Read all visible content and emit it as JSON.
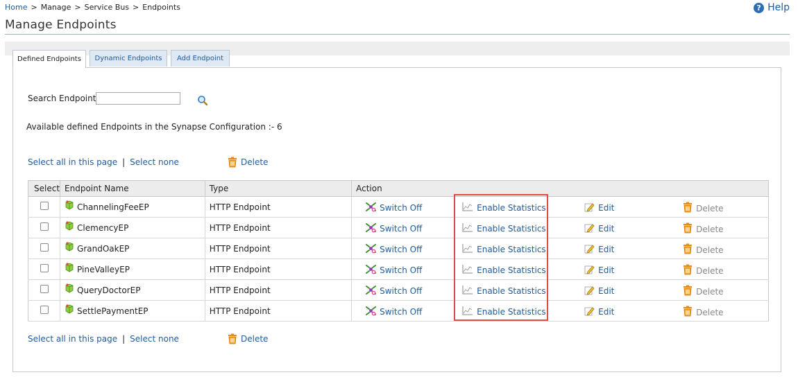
{
  "breadcrumb": [
    "Home",
    "Manage",
    "Service Bus",
    "Endpoints"
  ],
  "help_label": "Help",
  "page_title": "Manage Endpoints",
  "tabs": [
    {
      "label": "Defined Endpoints",
      "active": true
    },
    {
      "label": "Dynamic Endpoints",
      "active": false
    },
    {
      "label": "Add Endpoint",
      "active": false
    }
  ],
  "search": {
    "label": "Search Endpoint",
    "value": "",
    "placeholder": ""
  },
  "available_text": "Available defined Endpoints in the Synapse Configuration :- 6",
  "select_all_label": "Select all in this page",
  "select_none_label": "Select none",
  "bulk_delete_label": "Delete",
  "table": {
    "headers": [
      "Select",
      "Endpoint Name",
      "Type",
      "Action"
    ],
    "rows": [
      {
        "name": "ChannelingFeeEP",
        "type": "HTTP Endpoint"
      },
      {
        "name": "ClemencyEP",
        "type": "HTTP Endpoint"
      },
      {
        "name": "GrandOakEP",
        "type": "HTTP Endpoint"
      },
      {
        "name": "PineValleyEP",
        "type": "HTTP Endpoint"
      },
      {
        "name": "QueryDoctorEP",
        "type": "HTTP Endpoint"
      },
      {
        "name": "SettlePaymentEP",
        "type": "HTTP Endpoint"
      }
    ],
    "actions": {
      "switch": "Switch Off",
      "stats": "Enable Statistics",
      "edit": "Edit",
      "delete": "Delete"
    }
  },
  "colors": {
    "link": "#1f5b9c",
    "highlight": "#e04b45",
    "header_bg": "#ececec"
  }
}
